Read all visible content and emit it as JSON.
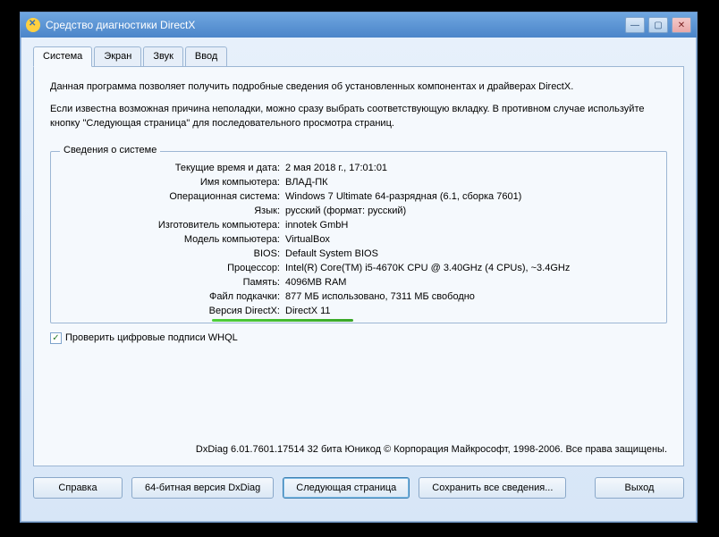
{
  "window": {
    "title": "Средство диагностики DirectX"
  },
  "tabs": [
    {
      "label": "Система",
      "active": true
    },
    {
      "label": "Экран",
      "active": false
    },
    {
      "label": "Звук",
      "active": false
    },
    {
      "label": "Ввод",
      "active": false
    }
  ],
  "intro": {
    "line1": "Данная программа позволяет получить подробные сведения об установленных компонентах и драйверах DirectX.",
    "line2": "Если известна возможная причина неполадки, можно сразу выбрать соответствующую вкладку. В противном случае используйте кнопку \"Следующая страница\" для последовательного просмотра страниц."
  },
  "sysinfo": {
    "legend": "Сведения о системе",
    "rows": [
      {
        "label": "Текущие время и дата:",
        "value": "2 мая 2018 г., 17:01:01"
      },
      {
        "label": "Имя компьютера:",
        "value": "ВЛАД-ПК"
      },
      {
        "label": "Операционная система:",
        "value": "Windows 7 Ultimate 64-разрядная (6.1, сборка 7601)"
      },
      {
        "label": "Язык:",
        "value": "русский (формат: русский)"
      },
      {
        "label": "Изготовитель компьютера:",
        "value": "innotek GmbH"
      },
      {
        "label": "Модель компьютера:",
        "value": "VirtualBox"
      },
      {
        "label": "BIOS:",
        "value": "Default System BIOS"
      },
      {
        "label": "Процессор:",
        "value": "Intel(R) Core(TM) i5-4670K CPU @ 3.40GHz (4 CPUs), ~3.4GHz"
      },
      {
        "label": "Память:",
        "value": "4096MB RAM"
      },
      {
        "label": "Файл подкачки:",
        "value": "877 МБ использовано, 7311 МБ свободно"
      },
      {
        "label": "Версия DirectX:",
        "value": "DirectX 11",
        "highlight": true
      }
    ]
  },
  "whql": {
    "checked": true,
    "label": "Проверить цифровые подписи WHQL"
  },
  "footer": "DxDiag 6.01.7601.17514 32 бита Юникод   © Корпорация Майкрософт, 1998-2006.  Все права защищены.",
  "buttons": {
    "help": "Справка",
    "x64": "64-битная версия DxDiag",
    "next": "Следующая страница",
    "save": "Сохранить все сведения...",
    "exit": "Выход"
  }
}
